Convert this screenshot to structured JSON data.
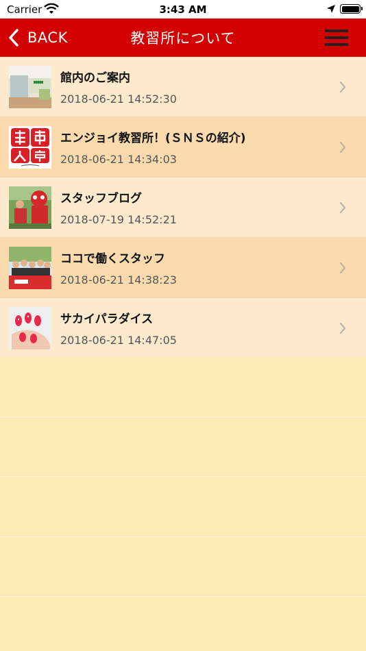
{
  "status_bar": {
    "carrier": "Carrier",
    "time": "3:43 AM",
    "icons": [
      "wifi-icon",
      "location-arrow-icon",
      "battery-icon"
    ]
  },
  "nav": {
    "back_label": "BACK",
    "title": "教習所について",
    "back_icon": "chevron-left-icon",
    "menu_icon": "hamburger-menu-icon"
  },
  "list": {
    "items": [
      {
        "title": "館内のご案内",
        "date": "2018-06-21 14:52:30",
        "thumb": "lobby-photo"
      },
      {
        "title": "エンジョイ教習所！(ＳＮＳの紹介)",
        "date": "2018-06-21 14:34:03",
        "thumb": "sns-logo"
      },
      {
        "title": "スタッフブログ",
        "date": "2018-07-19 14:52:21",
        "thumb": "mascot-photo"
      },
      {
        "title": "ココで働くスタッフ",
        "date": "2018-06-21 14:38:23",
        "thumb": "staff-group-photo"
      },
      {
        "title": "サカイパラダイス",
        "date": "2018-06-21 14:47:05",
        "thumb": "nails-photo"
      }
    ]
  },
  "colors": {
    "nav_background": "#d20000",
    "row_odd": "#fde9cc",
    "row_even": "#fbdbae",
    "page_background": "#faecb4"
  }
}
